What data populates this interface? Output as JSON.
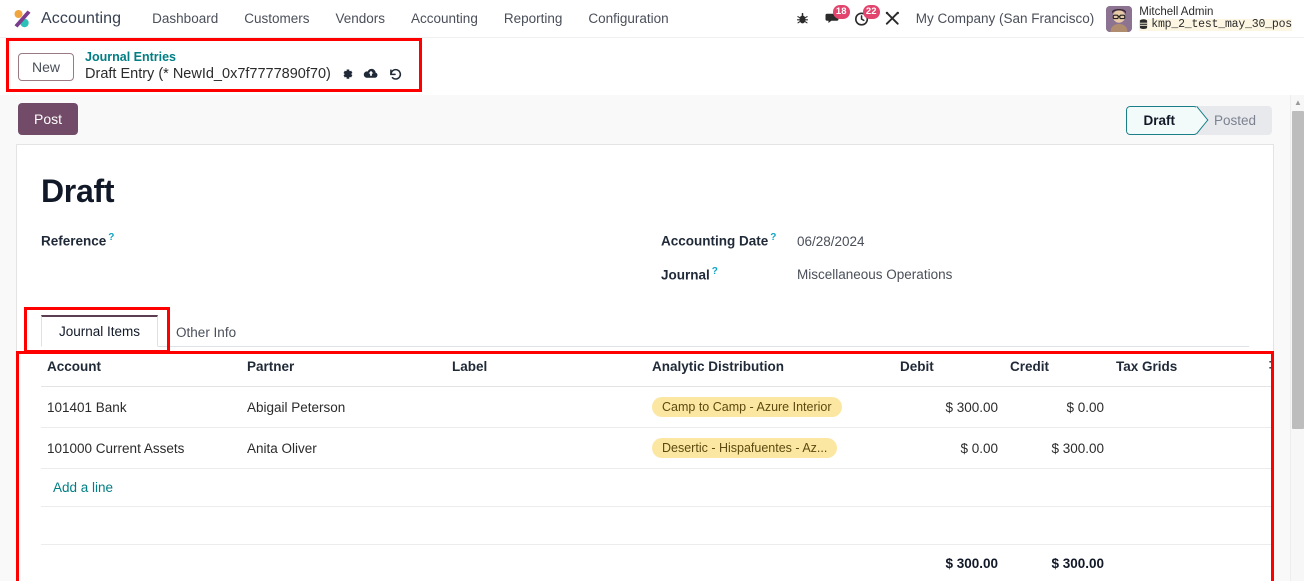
{
  "navbar": {
    "app_name": "Accounting",
    "logo_icon": "odoo-logo-icon",
    "menu": [
      {
        "label": "Dashboard"
      },
      {
        "label": "Customers"
      },
      {
        "label": "Vendors"
      },
      {
        "label": "Accounting"
      },
      {
        "label": "Reporting"
      },
      {
        "label": "Configuration"
      }
    ],
    "system_icons": [
      {
        "name": "bug-icon",
        "glyph": "🐞",
        "badge": null
      },
      {
        "name": "messages-icon",
        "glyph": "💬",
        "badge": "18"
      },
      {
        "name": "activities-clock-icon",
        "glyph": "⏱",
        "badge": "22"
      },
      {
        "name": "developer-tools-icon",
        "glyph": "⚒",
        "badge": null
      }
    ],
    "company": "My Company (San Francisco)",
    "user": {
      "name": "Mitchell Admin",
      "database": "kmp_2_test_may_30_pos",
      "database_icon": "database-icon",
      "avatar_icon": "user-avatar"
    }
  },
  "control_panel": {
    "new_button": "New",
    "breadcrumb_parent": "Journal Entries",
    "breadcrumb_current": "Draft Entry (* NewId_0x7f7777890f70)",
    "actions": [
      {
        "name": "gear-icon",
        "glyph": "⚙"
      },
      {
        "name": "cloud-upload-icon",
        "glyph": "☁"
      },
      {
        "name": "discard-undo-icon",
        "glyph": "↺"
      }
    ]
  },
  "status": {
    "post_button": "Post",
    "stages": [
      {
        "label": "Draft",
        "active": true
      },
      {
        "label": "Posted",
        "active": false
      }
    ]
  },
  "form": {
    "title": "Draft",
    "fields_left": [
      {
        "label": "Reference",
        "help": "?",
        "value": ""
      }
    ],
    "fields_right": [
      {
        "label": "Accounting Date",
        "help": "?",
        "value": "06/28/2024"
      },
      {
        "label": "Journal",
        "help": "?",
        "value": "Miscellaneous Operations"
      }
    ]
  },
  "tabs": [
    {
      "label": "Journal Items",
      "active": true
    },
    {
      "label": "Other Info",
      "active": false
    }
  ],
  "journal_items": {
    "columns": [
      "Account",
      "Partner",
      "Label",
      "Analytic Distribution",
      "Debit",
      "Credit",
      "Tax Grids"
    ],
    "optional_columns_icon": "column-options-icon",
    "rows": [
      {
        "account": "101401 Bank",
        "partner": "Abigail Peterson",
        "label": "",
        "analytic": "Camp to Camp - Azure Interior",
        "debit": "$ 300.00",
        "credit": "$ 0.00",
        "tax_grids": "",
        "delete_icon": "trash-icon"
      },
      {
        "account": "101000 Current Assets",
        "partner": "Anita Oliver",
        "label": "",
        "analytic": "Desertic - Hispafuentes - Az...",
        "debit": "$ 0.00",
        "credit": "$ 300.00",
        "tax_grids": "",
        "delete_icon": "trash-icon"
      }
    ],
    "add_line": "Add a line",
    "totals": {
      "debit": "$ 300.00",
      "credit": "$ 300.00"
    }
  },
  "colors": {
    "brand_purple": "#714b67",
    "link_teal": "#017e84",
    "badge_red": "#e3446d",
    "tag_yellow": "#fce7a2",
    "annotation_red": "#fe0000"
  },
  "annotations": [
    {
      "name": "breadcrumb-highlight"
    },
    {
      "name": "tabs-highlight"
    },
    {
      "name": "journal-items-table-highlight"
    }
  ]
}
